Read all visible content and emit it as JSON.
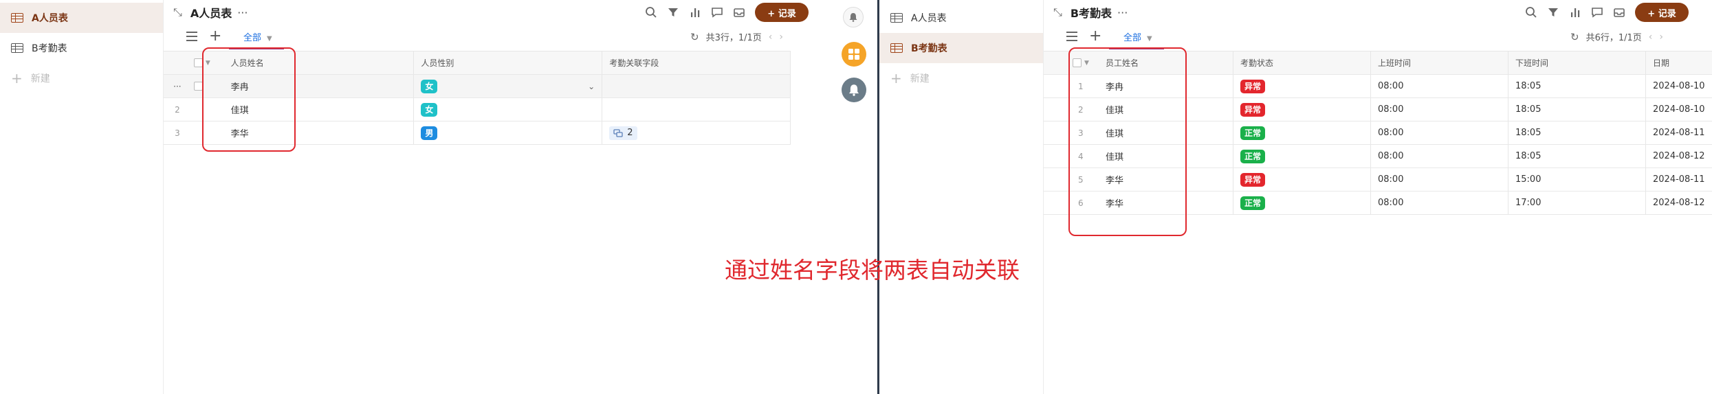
{
  "left": {
    "sidebar": {
      "items": [
        {
          "label": "A人员表",
          "active": true
        },
        {
          "label": "B考勤表",
          "active": false
        }
      ],
      "new_label": "新建"
    },
    "toolbar": {
      "title": "A人员表",
      "more": "···",
      "record_button": "+ 记录",
      "view_tab": "全部",
      "pagination": "共3行，1/1页"
    },
    "table": {
      "columns": [
        "人员姓名",
        "人员性别",
        "考勤关联字段"
      ],
      "rows": [
        {
          "index": "···",
          "name": "李冉",
          "gender": "女",
          "link": ""
        },
        {
          "index": "2",
          "name": "佳琪",
          "gender": "女",
          "link": ""
        },
        {
          "index": "3",
          "name": "李华",
          "gender": "男",
          "link": "2"
        }
      ]
    }
  },
  "right": {
    "sidebar": {
      "items": [
        {
          "label": "A人员表",
          "active": false
        },
        {
          "label": "B考勤表",
          "active": true
        }
      ],
      "new_label": "新建"
    },
    "toolbar": {
      "title": "B考勤表",
      "more": "···",
      "record_button": "+ 记录",
      "view_tab": "全部",
      "pagination": "共6行，1/1页"
    },
    "table": {
      "columns": [
        "员工姓名",
        "考勤状态",
        "上班时间",
        "下班时间",
        "日期"
      ],
      "rows": [
        {
          "index": "1",
          "name": "李冉",
          "status": "异常",
          "in": "08:00",
          "out": "18:05",
          "date": "2024-08-10"
        },
        {
          "index": "2",
          "name": "佳琪",
          "status": "异常",
          "in": "08:00",
          "out": "18:05",
          "date": "2024-08-10"
        },
        {
          "index": "3",
          "name": "佳琪",
          "status": "正常",
          "in": "08:00",
          "out": "18:05",
          "date": "2024-08-11"
        },
        {
          "index": "4",
          "name": "佳琪",
          "status": "正常",
          "in": "08:00",
          "out": "18:05",
          "date": "2024-08-12"
        },
        {
          "index": "5",
          "name": "李华",
          "status": "异常",
          "in": "08:00",
          "out": "15:00",
          "date": "2024-08-11"
        },
        {
          "index": "6",
          "name": "李华",
          "status": "正常",
          "in": "08:00",
          "out": "17:00",
          "date": "2024-08-12"
        }
      ]
    }
  },
  "caption": "通过姓名字段将两表自动关联",
  "colors": {
    "accent": "#8a3c12",
    "female": "#1fc1c8",
    "male": "#1d8ce0",
    "abnormal": "#e3262d",
    "normal": "#1ab04a",
    "annotation": "#e0282e"
  }
}
